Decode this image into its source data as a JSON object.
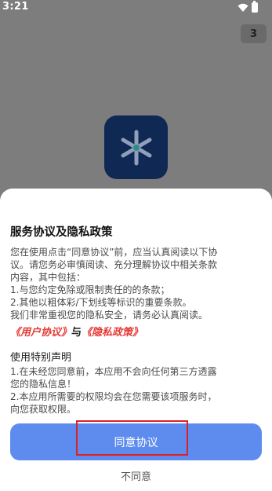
{
  "status_bar": {
    "time": "3:21"
  },
  "counter_badge": "3",
  "dialog": {
    "title": "服务协议及隐私政策",
    "intro_lines": [
      "您在使用点击“同意协议”前，应当认真阅读以下协",
      "议。请您务必审慎阅读、充分理解协议中相关条款",
      "内容，其中包括：",
      "1.与您约定免除或限制责任的的条款；",
      "2.其他以粗体彩/下划线等标识的重要条款。",
      "我们非常重视您的隐私安全，请务必认真阅读。"
    ],
    "links": {
      "user_agreement": "《用户协议》",
      "connector": "与",
      "privacy_policy": "《隐私政策》"
    },
    "notice_title": "使用特别声明",
    "notice_lines": [
      "1.在未经您同意前，本应用不会向任何第三方透露",
      "您的隐私信息！",
      "2.本应用所需要的权限均会在您需要该项服务时，",
      "向您获取权限。"
    ],
    "agree_label": "同意协议",
    "disagree_label": "不同意"
  },
  "colors": {
    "accent": "#5e8cee",
    "link": "#e53935",
    "highlight": "#e02020",
    "logo_bg": "#102854"
  },
  "icons": {
    "status": [
      "wifi-icon",
      "battery-icon"
    ],
    "logo": "app-logo-icon"
  }
}
